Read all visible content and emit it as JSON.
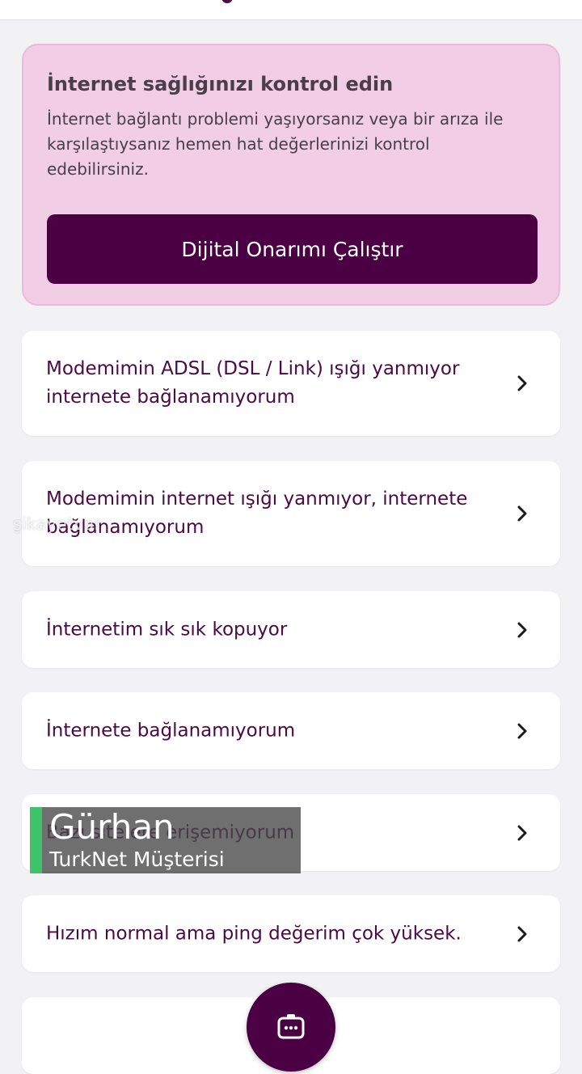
{
  "health": {
    "title": "İnternet sağlığınızı kontrol edin",
    "description": "İnternet bağlantı problemi yaşıyorsanız veya bir arıza ile karşılaştıysanız hemen hat değerlerinizi kontrol edebilirsiniz.",
    "button_label": "Dijital Onarımı Çalıştır"
  },
  "issues": [
    {
      "label": "Modemimin ADSL (DSL / Link) ışığı yanmıyor internete bağlanamıyorum"
    },
    {
      "label": "Modemimin internet ışığı yanmıyor, internete bağlanamıyorum"
    },
    {
      "label": "İnternetim sık sık kopuyor"
    },
    {
      "label": "İnternete bağlanamıyorum"
    },
    {
      "label": "Bazı sitelere erişemiyorum"
    },
    {
      "label": "Hızım normal ama ping değerim çok yüksek."
    },
    {
      "label": ""
    }
  ],
  "watermark": "şikayetvar",
  "caption": {
    "name": "Gürhan",
    "role": "TurkNet Müşterisi"
  },
  "icons": {
    "chevron": "chevron-right-icon",
    "fab": "chat-bot-icon"
  },
  "colors": {
    "brand": "#4a0042",
    "card_bg": "#f1cde6",
    "caption_accent": "#3fc36a"
  }
}
